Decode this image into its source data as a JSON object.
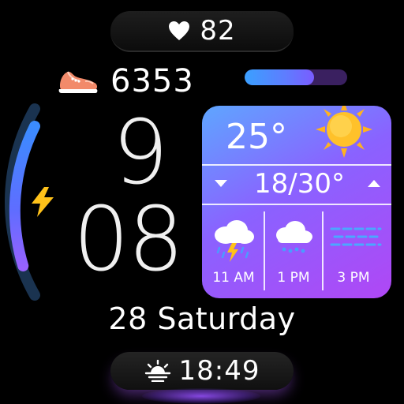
{
  "heart_rate": {
    "icon": "heart-icon",
    "value": "82"
  },
  "steps": {
    "icon": "sneaker-icon",
    "value": "6353"
  },
  "time": {
    "hour": "9",
    "minute": "08"
  },
  "date": {
    "label": "28 Saturday"
  },
  "sunset": {
    "icon": "sunset-icon",
    "time": "18:49"
  },
  "battery": {
    "icon": "lightning-bolt-icon",
    "level_fraction": 0.82,
    "colors": [
      "#2e6fff",
      "#a35cff",
      "#4ab4ff"
    ]
  },
  "progress_bar": {
    "fill_fraction": 0.68,
    "colors": [
      "#3aa0ff",
      "#7a5cff"
    ]
  },
  "weather": {
    "current_temp": "25°",
    "current_icon": "sun-icon",
    "range": "18/30°",
    "low_icon": "arrow-down-icon",
    "high_icon": "arrow-up-icon",
    "forecast": [
      {
        "time": "11 AM",
        "icon": "thunderstorm-icon"
      },
      {
        "time": "1 PM",
        "icon": "rain-cloud-icon"
      },
      {
        "time": "3 PM",
        "icon": "fog-icon"
      }
    ],
    "card_gradient": [
      "#5ea6ff",
      "#8a62ff",
      "#b047f5"
    ]
  },
  "accent_colors": {
    "glow": "#9650ff",
    "sun": "#ffb21e"
  }
}
